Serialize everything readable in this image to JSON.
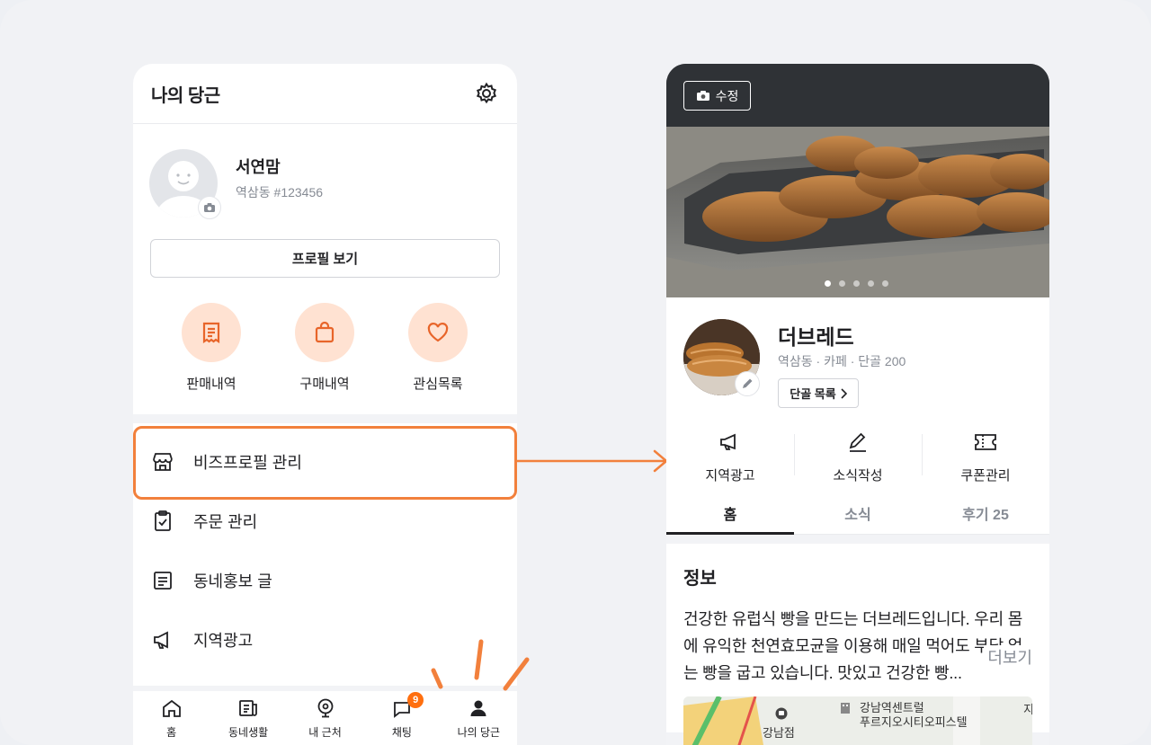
{
  "left_screen": {
    "title": "나의 당근",
    "profile": {
      "name": "서연맘",
      "subtitle": "역삼동 #123456",
      "view_button": "프로필 보기"
    },
    "shortcuts": [
      {
        "label": "판매내역",
        "icon": "receipt-icon"
      },
      {
        "label": "구매내역",
        "icon": "shopping-bag-icon"
      },
      {
        "label": "관심목록",
        "icon": "heart-icon"
      }
    ],
    "menu": [
      {
        "label": "비즈프로필 관리",
        "icon": "store-icon"
      },
      {
        "label": "주문 관리",
        "icon": "clipboard-check-icon"
      },
      {
        "label": "동네홍보 글",
        "icon": "document-icon"
      },
      {
        "label": "지역광고",
        "icon": "megaphone-icon"
      }
    ],
    "tabbar": [
      {
        "label": "홈",
        "icon": "home-icon"
      },
      {
        "label": "동네생활",
        "icon": "newspaper-icon"
      },
      {
        "label": "내 근처",
        "icon": "location-pin-icon"
      },
      {
        "label": "채팅",
        "icon": "chat-icon",
        "badge": "9"
      },
      {
        "label": "나의 당근",
        "icon": "person-icon"
      }
    ]
  },
  "right_screen": {
    "edit_label": "수정",
    "carousel": {
      "total": 5,
      "active": 1
    },
    "business": {
      "name": "더브레드",
      "subtitle": "역삼동 · 카페 · 단골 200",
      "regulars_button": "단골 목록"
    },
    "actions": [
      {
        "label": "지역광고",
        "icon": "megaphone-icon"
      },
      {
        "label": "소식작성",
        "icon": "pencil-icon"
      },
      {
        "label": "쿠폰관리",
        "icon": "ticket-icon"
      }
    ],
    "tabs": [
      {
        "label": "홈",
        "active": true
      },
      {
        "label": "소식",
        "active": false
      },
      {
        "label": "후기 25",
        "active": false
      }
    ],
    "info": {
      "title": "정보",
      "text": "건강한 유럽식 빵을 만드는 더브레드입니다. 우리 몸에 유익한 천연효모균을 이용해 매일 먹어도 부담 없는 빵을 굽고 있습니다. 맛있고 건강한 빵...",
      "more": "더보기"
    },
    "map": {
      "labels": [
        "강남역센트럴",
        "푸르지오시티오피스텔",
        "지",
        "강남점"
      ]
    }
  },
  "colors": {
    "accent": "#ff6f0f",
    "highlight": "#f2803c",
    "icon_circle": "#ffe2d2"
  }
}
